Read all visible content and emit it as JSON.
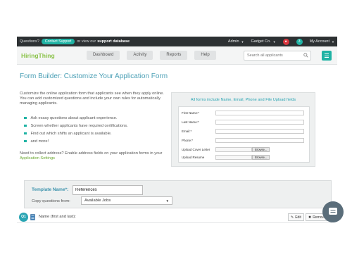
{
  "topbar": {
    "questions_label": "Questions?",
    "contact_button": "Contact Support",
    "or_view": "or view our",
    "support_db": "support database",
    "admin": "Admin",
    "company": "Gadget Co.",
    "notifications_count": "3",
    "my_account": "My Account"
  },
  "nav": {
    "logo": "HiringThing",
    "dashboard": "Dashboard",
    "activity": "Activity",
    "reports": "Reports",
    "help": "Help",
    "search_placeholder": "Search all applicants"
  },
  "page": {
    "title": "Form Builder: Customize Your Application Form",
    "intro": "Customize the online application form that applicants see when they apply online. You can add customized questions and include your own rules for automatically managing applicants.",
    "bullets": [
      "Ask essay questions about applicant experience.",
      "Screen whether applicants have required certifications.",
      "Find out which shifts an applicant is available.",
      "and more!"
    ],
    "address_text": "Need to collect address? Enable address fields on your application forms in your",
    "address_link": "Application Settings"
  },
  "preview": {
    "heading": "All forms include Name, Email, Phone and File Upload fields",
    "fields": {
      "first_name": "First Name:*",
      "last_name": "Last Name:*",
      "email": "Email:*",
      "phone": "Phone:*",
      "cover_letter": "Upload Cover Letter",
      "resume": "Upload Resume"
    },
    "browse": "Browse..."
  },
  "template": {
    "name_label": "Template Name*:",
    "name_value": "References",
    "copy_label": "Copy questions from:",
    "copy_value": "Available Jobs"
  },
  "question": {
    "badge": "Q1",
    "text": "Name (first and last):",
    "edit": "Edit",
    "remove": "Remove"
  },
  "colors": {
    "accent": "#1fb3a4",
    "brand_green": "#8bc34a",
    "title_blue": "#4a9fb5",
    "dark_bar": "#2d3133",
    "alert_red": "#d9363e"
  }
}
